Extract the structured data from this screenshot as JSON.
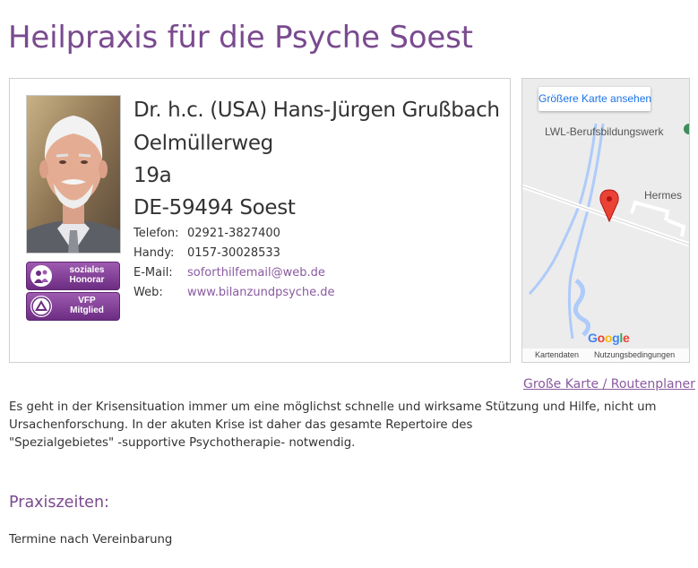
{
  "page": {
    "title": "Heilpraxis für die Psyche Soest"
  },
  "contact": {
    "name": "Dr. h.c. (USA) Hans-Jürgen Grußbach",
    "street": "Oelmüllerweg",
    "house_number": "19a",
    "city": "DE-59494 Soest",
    "phone_label": "Telefon:",
    "phone": "02921-3827400",
    "mobile_label": "Handy:",
    "mobile": "0157-30028533",
    "email_label": "E-Mail:",
    "email": "soforthilfemail@web.de",
    "web_label": "Web:",
    "web": "www.bilanzundpsyche.de"
  },
  "badges": [
    {
      "line1": "soziales",
      "line2": "Honorar",
      "icon": "people-icon"
    },
    {
      "line1": "VFP",
      "line2": "Mitglied",
      "icon": "vfp-logo-icon"
    }
  ],
  "map": {
    "button": "Größere Karte ansehen",
    "place_1": "LWL-Berufsbildungswerk",
    "place_2": "Hermes",
    "logo": "Google",
    "footer_data": "Kartendaten",
    "footer_terms": "Nutzungsbedingungen",
    "colors": {
      "water": "#aecbfa",
      "road": "#ffffff",
      "pin": "#ea4335"
    }
  },
  "route_link": "Große Karte / Routenplaner",
  "intro": {
    "line1": "Es geht in der Krisensituation immer um eine möglichst schnelle und wirksame Stützung und Hilfe, nicht um",
    "line2": "Ursachenforschung. In der akuten Krise ist daher das gesamte Repertoire des",
    "line3": "\"Spezialgebietes\" -supportive Psychotherapie- notwendig."
  },
  "hours": {
    "heading": "Praxiszeiten:",
    "text": "Termine nach Vereinbarung"
  },
  "theme": {
    "accent": "#7a4a8f",
    "link": "#8a5aa0"
  }
}
